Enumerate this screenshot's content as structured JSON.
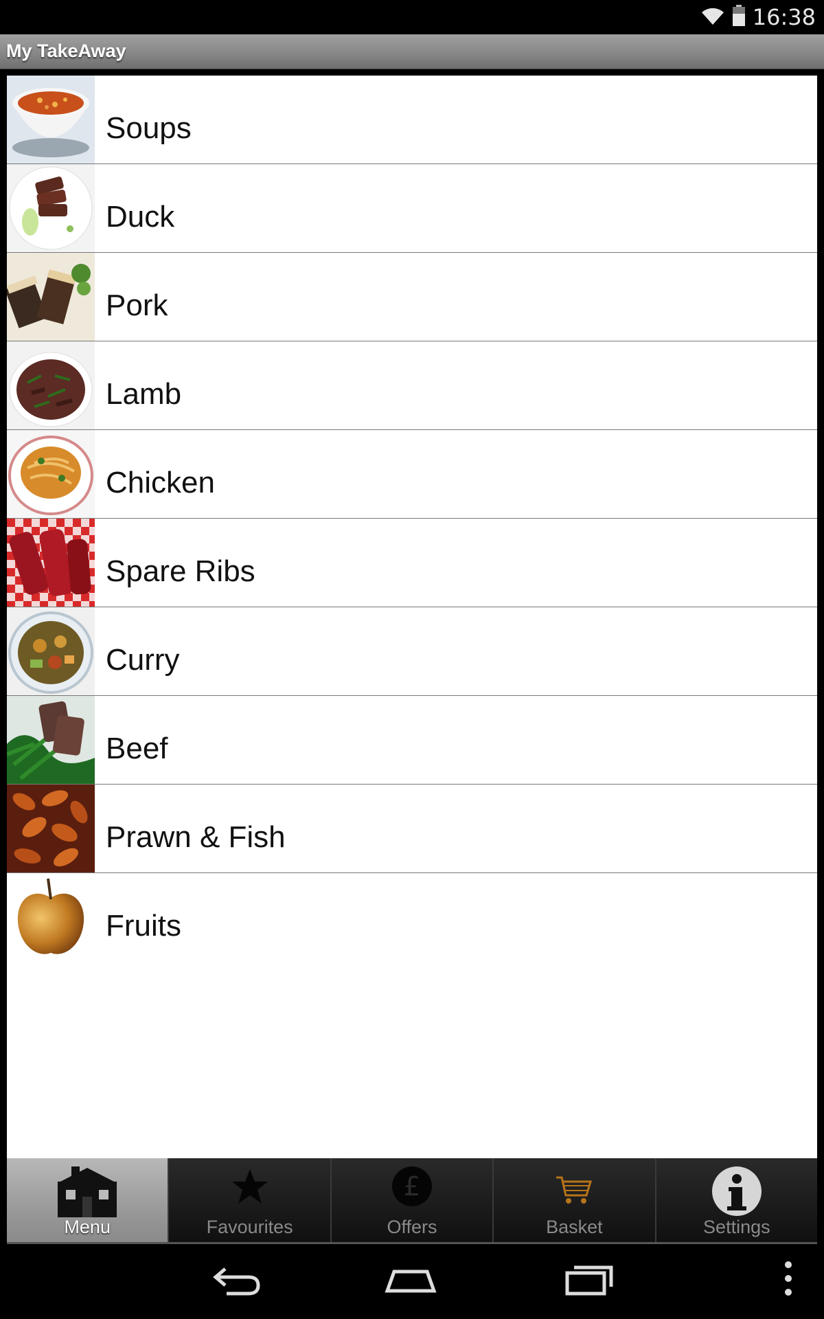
{
  "status": {
    "time": "16:38",
    "icons": [
      "wifi-icon",
      "battery-icon"
    ]
  },
  "app": {
    "title": "My TakeAway"
  },
  "menu": {
    "items": [
      {
        "label": "Soups",
        "icon": "soup-bowl-thumbnail"
      },
      {
        "label": "Duck",
        "icon": "duck-dish-thumbnail"
      },
      {
        "label": "Pork",
        "icon": "pork-belly-thumbnail"
      },
      {
        "label": "Lamb",
        "icon": "lamb-stirfry-thumbnail"
      },
      {
        "label": "Chicken",
        "icon": "chicken-noodles-thumbnail"
      },
      {
        "label": "Spare Ribs",
        "icon": "spare-ribs-thumbnail"
      },
      {
        "label": "Curry",
        "icon": "curry-bowl-thumbnail"
      },
      {
        "label": "Beef",
        "icon": "beef-greens-thumbnail"
      },
      {
        "label": "Prawn & Fish",
        "icon": "prawns-thumbnail"
      },
      {
        "label": "Fruits",
        "icon": "apple-thumbnail"
      }
    ]
  },
  "tabs": [
    {
      "label": "Menu",
      "icon": "house-icon",
      "active": true
    },
    {
      "label": "Favourites",
      "icon": "star-icon",
      "active": false
    },
    {
      "label": "Offers",
      "icon": "pound-coin-icon",
      "active": false
    },
    {
      "label": "Basket",
      "icon": "cart-icon",
      "active": false
    },
    {
      "label": "Settings",
      "icon": "info-icon",
      "active": false
    }
  ],
  "navbar": [
    "back-icon",
    "home-icon",
    "recent-apps-icon",
    "overflow-menu-icon"
  ]
}
